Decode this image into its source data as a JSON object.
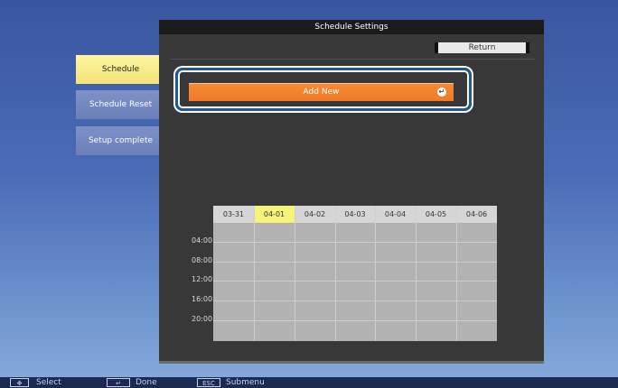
{
  "window": {
    "title": "Schedule Settings"
  },
  "sidebar": {
    "items": [
      {
        "label": "Schedule",
        "state": "active"
      },
      {
        "label": "Schedule Reset",
        "state": "idle"
      },
      {
        "label": "Setup complete",
        "state": "idle"
      }
    ]
  },
  "header": {
    "return_label": "Return"
  },
  "main": {
    "add_new_label": "Add New",
    "enter_icon": "enter-icon"
  },
  "calendar": {
    "days": [
      "03-31",
      "04-01",
      "04-02",
      "04-03",
      "04-04",
      "04-05",
      "04-06"
    ],
    "selected_day": "04-01",
    "hours": [
      "04:00",
      "08:00",
      "12:00",
      "16:00",
      "20:00"
    ]
  },
  "statusbar": {
    "select_label": "Select",
    "done_label": "Done",
    "submenu_label": "Submenu",
    "esc_key": "ESC"
  },
  "colors": {
    "accent": "#f07a25",
    "selected_day": "#f6f27a",
    "focus_ring": "#1f5b92"
  }
}
